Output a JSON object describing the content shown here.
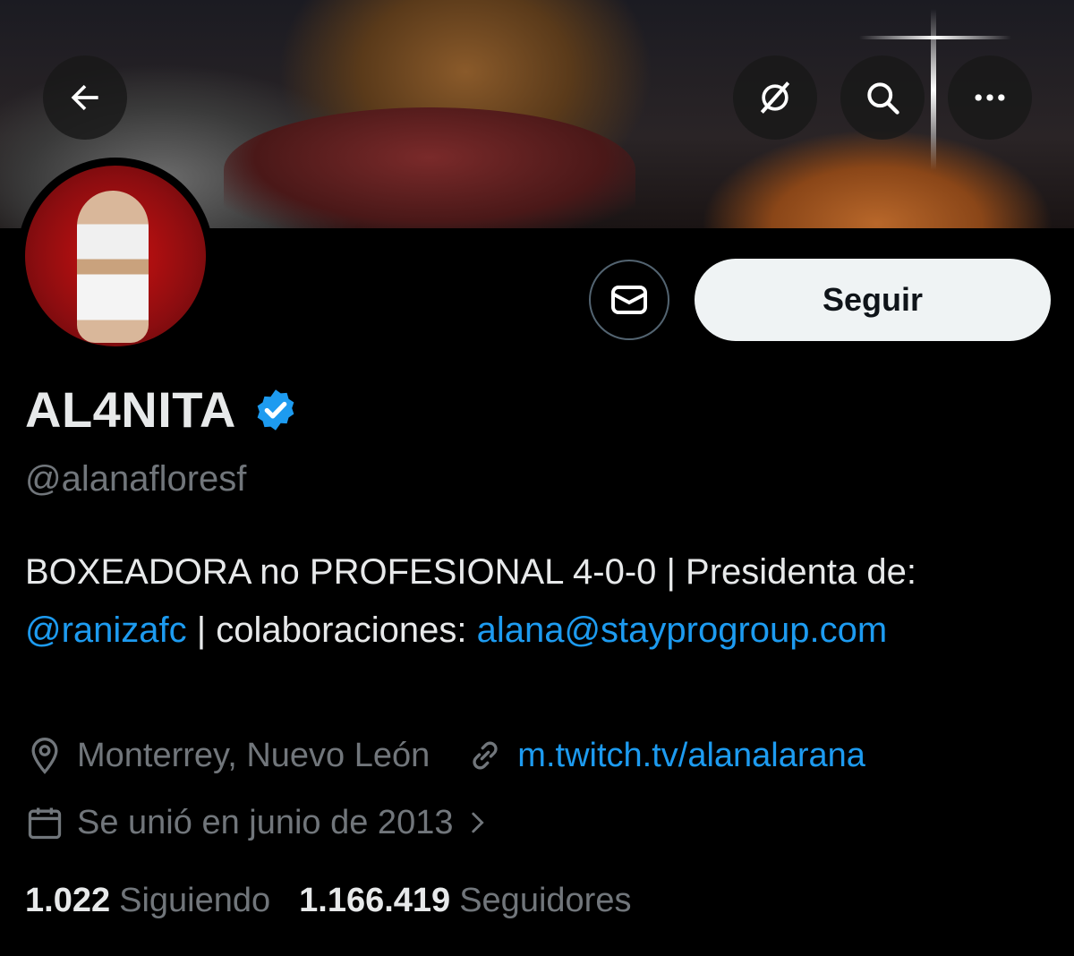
{
  "header": {
    "back_icon": "arrow-left-icon",
    "grok_icon": "grok-icon",
    "search_icon": "search-icon",
    "more_icon": "more-horizontal-icon"
  },
  "profile": {
    "name": "AL4NITA",
    "handle": "@alanafloresf",
    "verified": true,
    "verified_color": "#1d9bf0",
    "bio_part1": "BOXEADORA no PROFESIONAL 4-0-0 | Presidenta de: ",
    "bio_mention": "@ranizafc",
    "bio_part2": " | colaboraciones: ",
    "bio_email": "alana@stayprogroup.com",
    "location": "Monterrey, Nuevo León",
    "website": "m.twitch.tv/alanalarana",
    "joined": "Se unió en junio de 2013",
    "following_count": "1.022",
    "following_label": "Siguiendo",
    "followers_count": "1.166.419",
    "followers_label": "Seguidores"
  },
  "actions": {
    "message_icon": "envelope-icon",
    "follow_label": "Seguir"
  },
  "colors": {
    "background": "#000000",
    "text": "#e7e9ea",
    "muted": "#71767b",
    "link": "#1d9bf0",
    "follow_bg": "#eff3f4"
  }
}
